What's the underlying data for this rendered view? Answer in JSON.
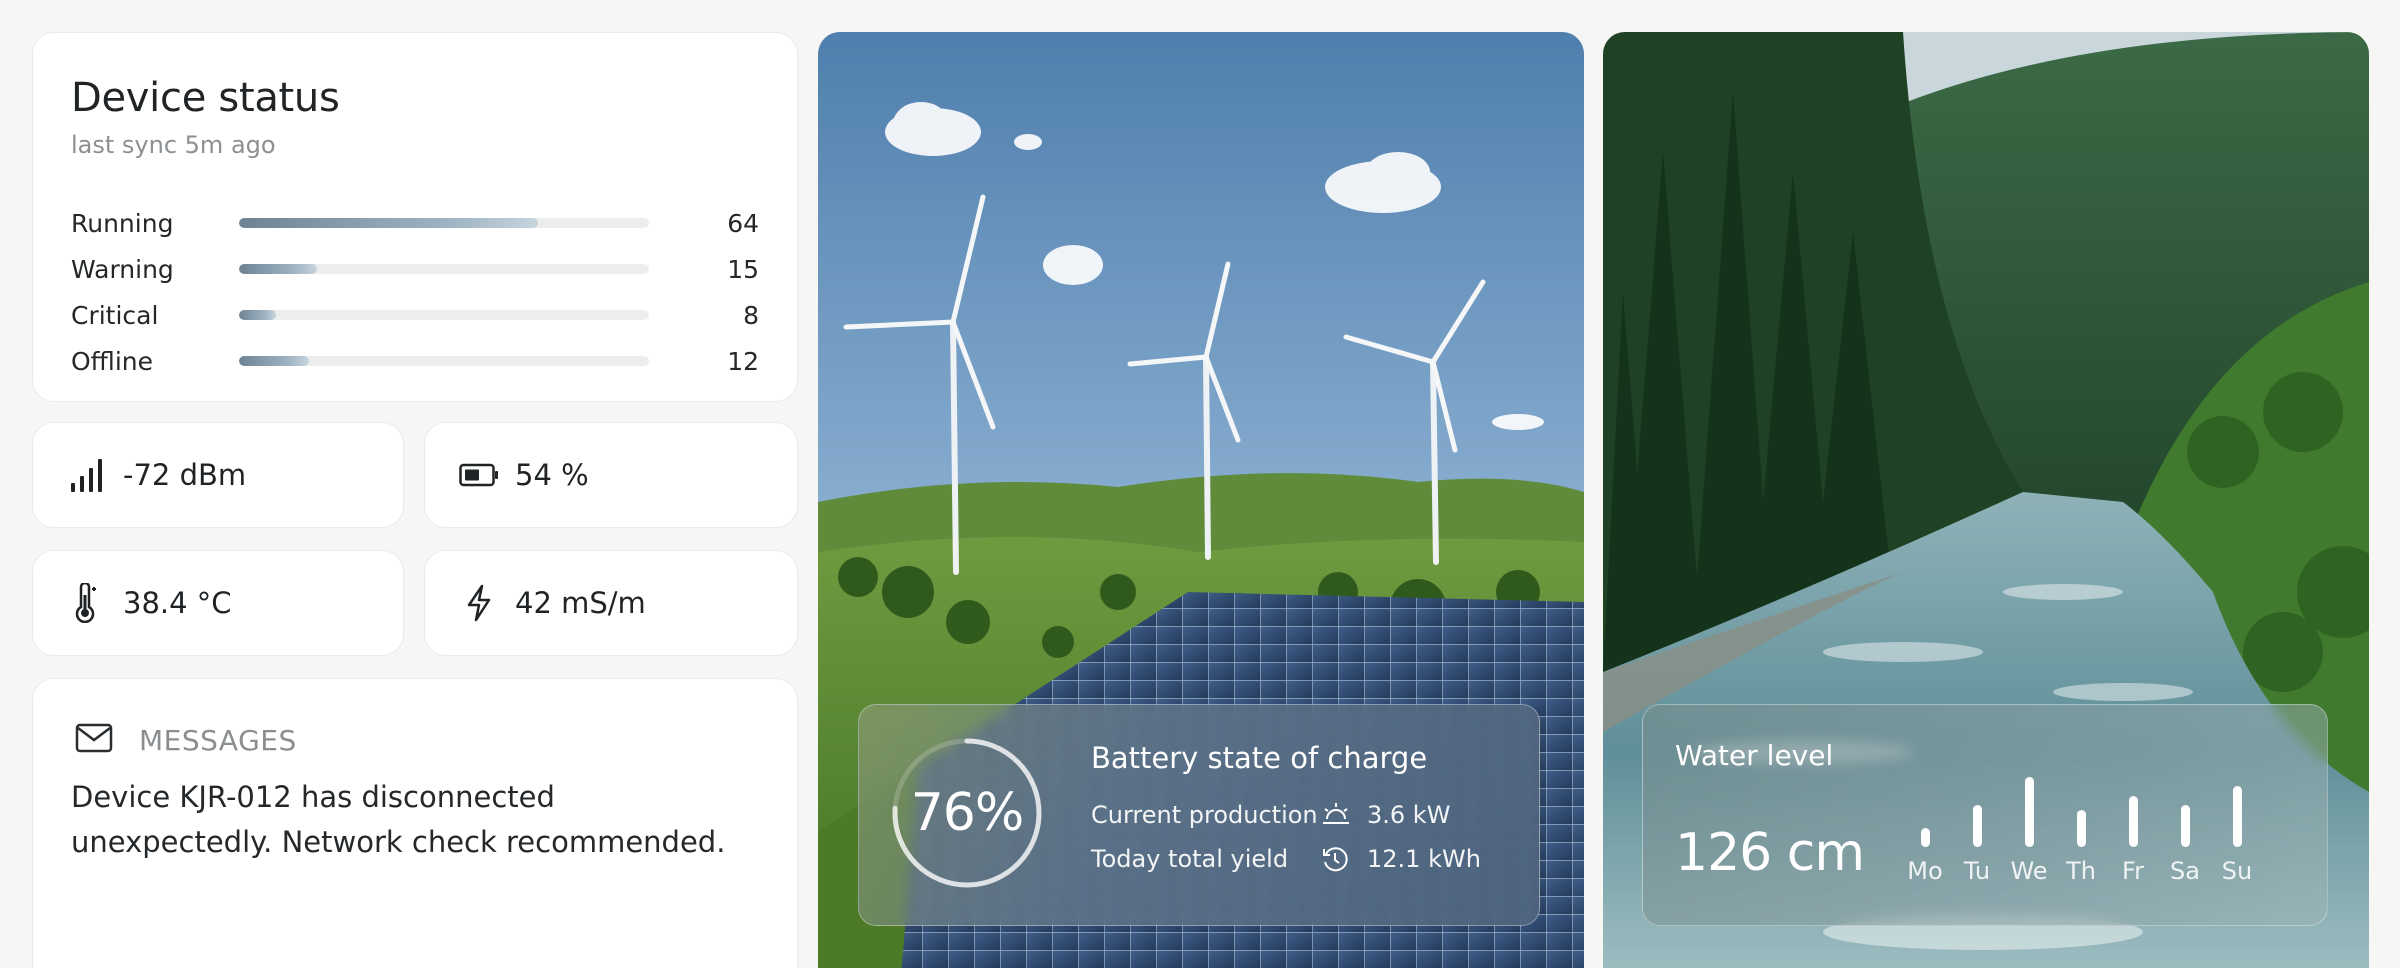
{
  "device_status": {
    "title": "Device status",
    "subtitle": "last sync 5m ago",
    "max": 100,
    "rows": [
      {
        "label": "Running",
        "value": 64,
        "fraction": 0.73
      },
      {
        "label": "Warning",
        "value": 15,
        "fraction": 0.19
      },
      {
        "label": "Critical",
        "value": 8,
        "fraction": 0.09
      },
      {
        "label": "Offline",
        "value": 12,
        "fraction": 0.17
      }
    ]
  },
  "stats": {
    "signal": {
      "value": "-72 dBm",
      "icon": "signal-bars-icon"
    },
    "battery": {
      "value": "54 %",
      "icon": "battery-icon"
    },
    "temperature": {
      "value": "38.4 °C",
      "icon": "thermometer-icon"
    },
    "conductivity": {
      "value": "42 mS/m",
      "icon": "lightning-icon"
    }
  },
  "messages": {
    "title": "MESSAGES",
    "icon": "envelope-icon",
    "body": "Device KJR-012 has disconnected unexpectedly. Network check recommended."
  },
  "battery_panel": {
    "gauge_value": "76%",
    "gauge_fraction": 0.76,
    "title": "Battery state of charge",
    "rows": [
      {
        "label": "Current production",
        "icon": "sunrise-icon",
        "value": "3.6 kW"
      },
      {
        "label": "Today total yield",
        "icon": "history-icon",
        "value": "12.1 kWh"
      }
    ]
  },
  "water_panel": {
    "title": "Water level",
    "value": "126 cm",
    "days": [
      {
        "label": "Mo",
        "level": 0.27
      },
      {
        "label": "Tu",
        "level": 0.6
      },
      {
        "label": "We",
        "level": 1.0
      },
      {
        "label": "Th",
        "level": 0.53
      },
      {
        "label": "Fr",
        "level": 0.73
      },
      {
        "label": "Sa",
        "level": 0.6
      },
      {
        "label": "Su",
        "level": 0.87
      }
    ]
  },
  "colors": {
    "accent": "#7a8f9f",
    "card_bg": "#ffffff",
    "page_bg": "#f6f6f5"
  }
}
